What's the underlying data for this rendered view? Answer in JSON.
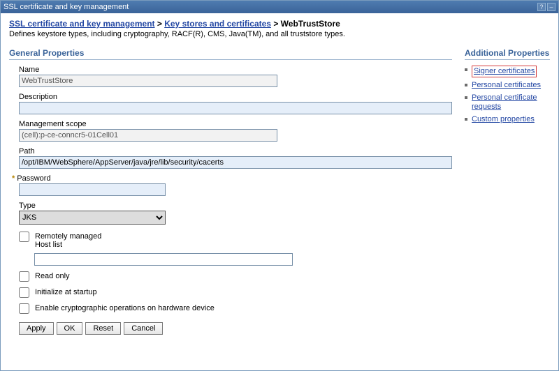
{
  "window": {
    "title": "SSL certificate and key management"
  },
  "breadcrumb": {
    "link1": "SSL certificate and key management",
    "link2": "Key stores and certificates",
    "current": "WebTrustStore"
  },
  "description": "Defines keystore types, including cryptography, RACF(R), CMS, Java(TM), and all truststore types.",
  "section": {
    "general": "General Properties",
    "additional": "Additional Properties"
  },
  "labels": {
    "name": "Name",
    "description": "Description",
    "mgmt_scope": "Management scope",
    "path": "Path",
    "password": "Password",
    "type": "Type",
    "remotely_managed": "Remotely managed",
    "host_list": "Host list",
    "read_only": "Read only",
    "init_startup": "Initialize at startup",
    "crypto_hw": "Enable cryptographic operations on hardware device"
  },
  "values": {
    "name": "WebTrustStore",
    "description": "",
    "mgmt_scope": "(cell):p-ce-conncr5-01Cell01",
    "path": "/opt/IBM/WebSphere/AppServer/java/jre/lib/security/cacerts",
    "password": "",
    "type": "JKS",
    "host_list": ""
  },
  "buttons": {
    "apply": "Apply",
    "ok": "OK",
    "reset": "Reset",
    "cancel": "Cancel"
  },
  "side_links": {
    "signer": "Signer certificates",
    "personal": "Personal certificates",
    "personal_req": "Personal certificate requests",
    "custom": "Custom properties"
  }
}
